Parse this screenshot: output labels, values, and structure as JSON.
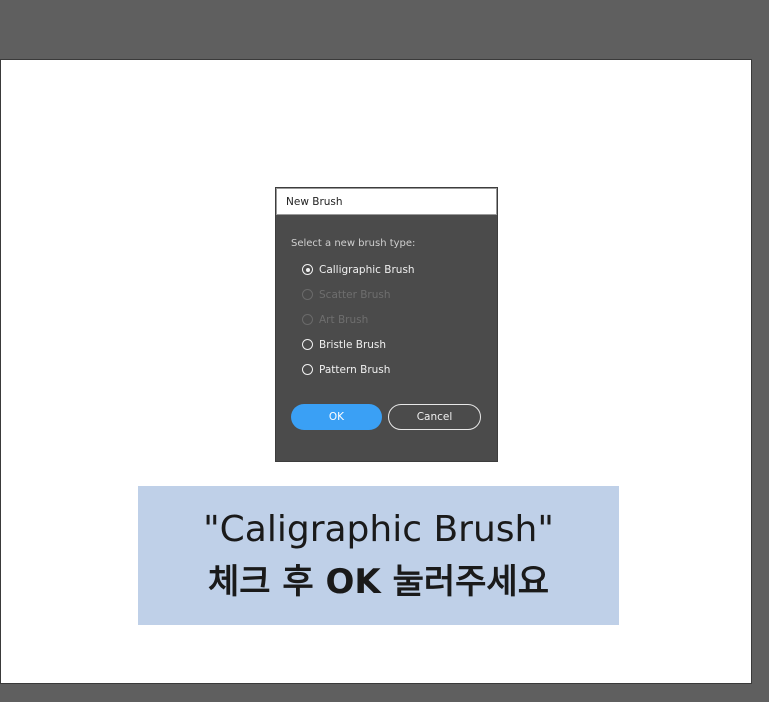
{
  "dialog": {
    "title": "New Brush",
    "prompt": "Select a new brush type:",
    "options": [
      {
        "label": "Calligraphic Brush",
        "checked": true,
        "enabled": true
      },
      {
        "label": "Scatter Brush",
        "checked": false,
        "enabled": false
      },
      {
        "label": "Art Brush",
        "checked": false,
        "enabled": false
      },
      {
        "label": "Bristle Brush",
        "checked": false,
        "enabled": true
      },
      {
        "label": "Pattern Brush",
        "checked": false,
        "enabled": true
      }
    ],
    "ok_label": "OK",
    "cancel_label": "Cancel"
  },
  "caption": {
    "line1": "\"Caligraphic Brush\"",
    "line2": "체크 후 OK 눌러주세요"
  },
  "colors": {
    "workspace": "#5f5f5f",
    "dialog_bg": "#4b4b4b",
    "ok_button": "#3aa0f5",
    "caption_bg": "#bfd0e8"
  }
}
